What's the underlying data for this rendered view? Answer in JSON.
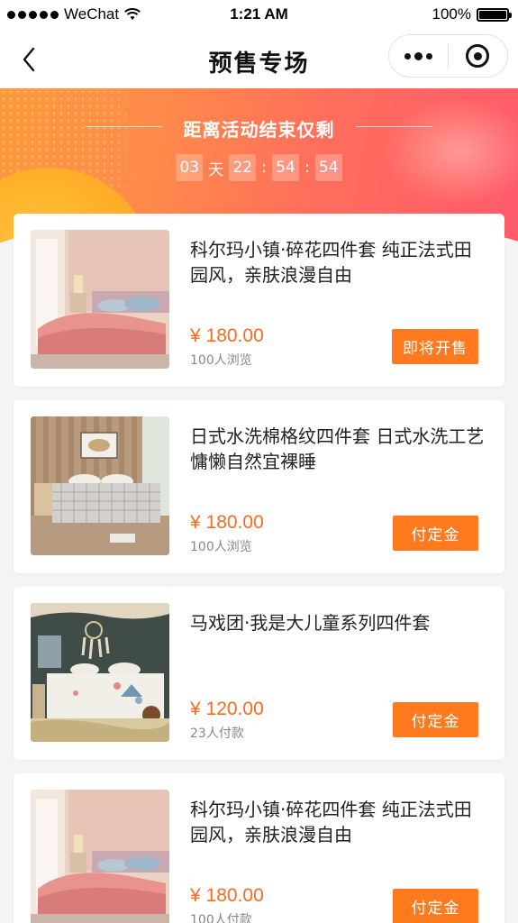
{
  "status_bar": {
    "carrier": "WeChat",
    "time": "1:21 AM",
    "battery": "100%"
  },
  "nav": {
    "title": "预售专场"
  },
  "banner": {
    "title": "距离活动结束仅剩",
    "countdown": {
      "days": "03",
      "days_label": "天",
      "hours": "22",
      "minutes": "54",
      "seconds": "54",
      "separator": ":"
    }
  },
  "colors": {
    "accent": "#ff7a1f",
    "price": "#ff6a1e",
    "banner_start": "#ff9a3a",
    "banner_end": "#ff5a6c"
  },
  "products": [
    {
      "title": "科尔玛小镇·碎花四件套 纯正法式田园风，亲肤浪漫自由",
      "price": "¥ 180.00",
      "meta": "100人浏览",
      "button": "即将开售"
    },
    {
      "title": "日式水洗棉格纹四件套 日式水洗工艺慵懒自然宜裸睡",
      "price": "¥ 180.00",
      "meta": "100人浏览",
      "button": "付定金"
    },
    {
      "title": "马戏团·我是大儿童系列四件套",
      "price": "¥ 120.00",
      "meta": "23人付款",
      "button": "付定金"
    },
    {
      "title": "科尔玛小镇·碎花四件套 纯正法式田园风，亲肤浪漫自由",
      "price": "¥ 180.00",
      "meta": "100人付款",
      "button": "付定金"
    }
  ]
}
